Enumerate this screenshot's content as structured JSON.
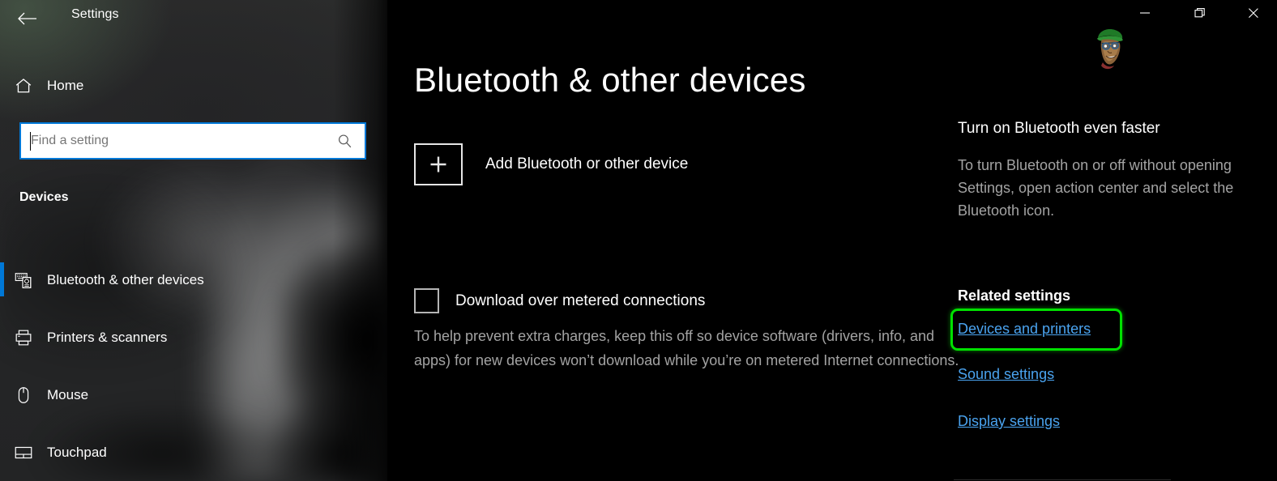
{
  "window": {
    "title": "Settings",
    "back_icon": "back-arrow-icon",
    "minimize_label": "Minimize",
    "maximize_label": "Maximize",
    "close_label": "Close",
    "accent_color": "#0078d7",
    "highlight_color": "#00e100",
    "link_color": "#4aa3ef"
  },
  "sidebar": {
    "home": {
      "label": "Home",
      "icon": "home-icon"
    },
    "search": {
      "value": "",
      "placeholder": "Find a setting",
      "icon": "search-icon"
    },
    "section_heading": "Devices",
    "items": [
      {
        "label": "Bluetooth & other devices",
        "icon": "bluetooth-devices-icon",
        "selected": true
      },
      {
        "label": "Printers & scanners",
        "icon": "printer-icon",
        "selected": false
      },
      {
        "label": "Mouse",
        "icon": "mouse-icon",
        "selected": false
      },
      {
        "label": "Touchpad",
        "icon": "touchpad-icon",
        "selected": false
      }
    ]
  },
  "main": {
    "page_title": "Bluetooth & other devices",
    "add_device": {
      "label": "Add Bluetooth or other device",
      "icon": "plus-icon"
    },
    "metered": {
      "label": "Download over metered connections",
      "checked": false,
      "description": "To help prevent extra charges, keep this off so device software (drivers, info, and apps) for new devices won’t download while you’re on metered Internet connections."
    }
  },
  "right_panel": {
    "tip_title": "Turn on Bluetooth even faster",
    "tip_body": "To turn Bluetooth on or off without opening Settings, open action center and select the Bluetooth icon.",
    "related_title": "Related settings",
    "related_links": [
      {
        "label": "Devices and printers",
        "highlighted": true
      },
      {
        "label": "Sound settings",
        "highlighted": false
      },
      {
        "label": "Display settings",
        "highlighted": false
      }
    ]
  }
}
